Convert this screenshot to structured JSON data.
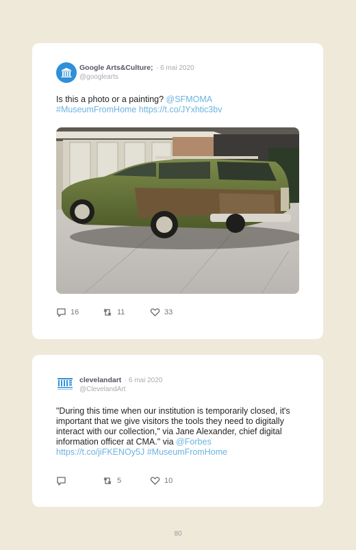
{
  "tweets": [
    {
      "account_name": "Google Arts&Culture;",
      "date": "· 6 mai 2020",
      "handle": "@googlearts",
      "text_plain": "Is this a photo or a painting? ",
      "mention": "@SFMOMA",
      "hashtag": "#MuseumFromHome",
      "url": "https://t.co/JYxhtic3bv",
      "replies": "16",
      "retweets": "11",
      "likes": "33",
      "avatar_icon": "museum-icon",
      "avatar_color": "#2f8fd8"
    },
    {
      "account_name": "clevelandart",
      "date": "· 6 mai 2020",
      "handle": "@ClevelandArt",
      "text_plain": "\"During this time when our institution is temporarily closed, it's important that we give visitors the tools they need to digitally interact with our collection,\" via Jane Alexander, chief digital information officer at CMA.\" via ",
      "mention": "@Forbes",
      "url": "https://t.co/jiFKENOy5J",
      "hashtag": "#MuseumFromHome",
      "replies": "",
      "retweets": "5",
      "likes": "10",
      "avatar_icon": "cleveland-museum-logo-icon",
      "avatar_color": "#2f8fd8"
    }
  ],
  "page_number": "80",
  "colors": {
    "background": "#efe9da",
    "link": "#6ab3e0",
    "card": "#ffffff"
  }
}
